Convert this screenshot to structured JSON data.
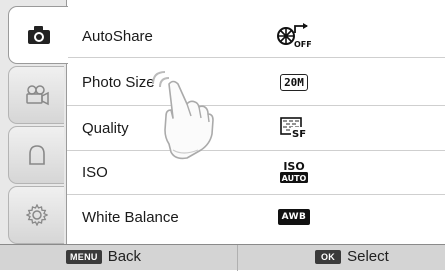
{
  "tabs": [
    {
      "name": "camera-icon",
      "active": true
    },
    {
      "name": "movie-camera-icon",
      "active": false
    },
    {
      "name": "person-icon",
      "active": false
    },
    {
      "name": "gear-icon",
      "active": false
    }
  ],
  "menu": {
    "items": [
      {
        "label": "AutoShare",
        "icon": "autoshare-off-icon",
        "value": "OFF"
      },
      {
        "label": "Photo Size",
        "icon": "photo-size-20m-icon",
        "value": "20M"
      },
      {
        "label": "Quality",
        "icon": "quality-superfine-icon",
        "value": "SF"
      },
      {
        "label": "ISO",
        "icon": "iso-auto-icon",
        "value_top": "ISO",
        "value_bottom": "AUTO"
      },
      {
        "label": "White Balance",
        "icon": "white-balance-auto-icon",
        "value": "AWB"
      }
    ]
  },
  "bottom": {
    "menu_key": "MENU",
    "back_label": "Back",
    "ok_key": "OK",
    "select_label": "Select"
  }
}
